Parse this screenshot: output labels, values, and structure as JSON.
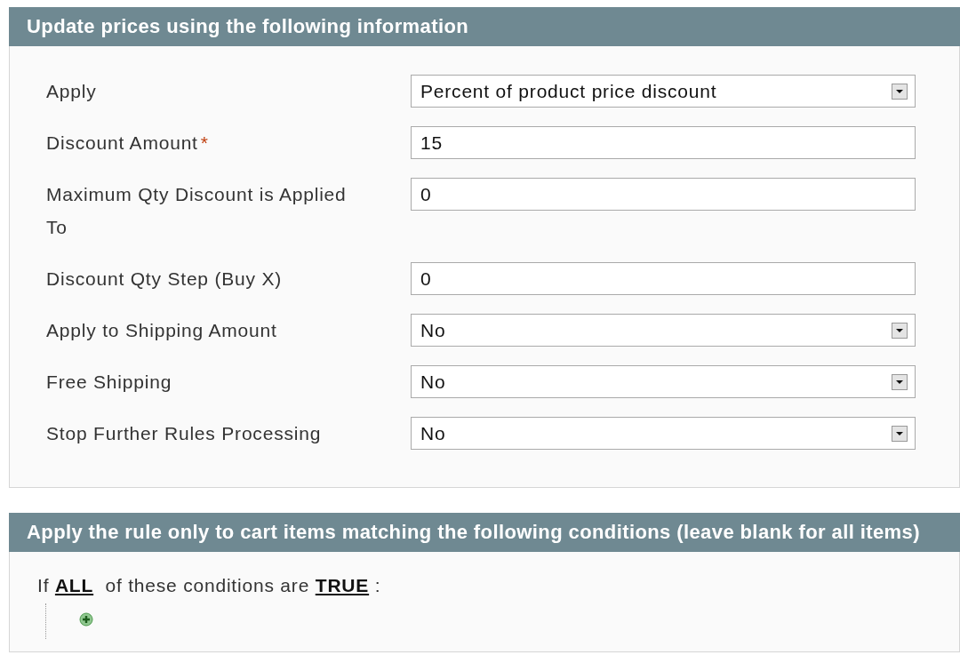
{
  "sections": [
    {
      "title": "Update prices using the following information",
      "fields": [
        {
          "label": "Apply",
          "kind": "select",
          "value": "Percent of product price discount"
        },
        {
          "label": "Discount Amount",
          "kind": "text",
          "value": "15",
          "required_mark": "*"
        },
        {
          "label": "Maximum Qty Discount is Applied To",
          "kind": "text",
          "value": "0"
        },
        {
          "label": "Discount Qty Step (Buy X)",
          "kind": "text",
          "value": "0"
        },
        {
          "label": "Apply to Shipping Amount",
          "kind": "select",
          "value": "No"
        },
        {
          "label": "Free Shipping",
          "kind": "select",
          "value": "No"
        },
        {
          "label": "Stop Further Rules Processing",
          "kind": "select",
          "value": "No"
        }
      ]
    },
    {
      "title": "Apply the rule only to cart items matching the following conditions (leave blank for all items)",
      "conditions": {
        "prefix": "If",
        "aggregator": "ALL",
        "middle": "of these conditions are",
        "value": "TRUE",
        "suffix": ":"
      }
    }
  ]
}
